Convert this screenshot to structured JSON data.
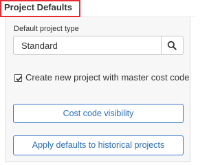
{
  "section": {
    "title": "Project Defaults"
  },
  "default_project_type": {
    "label": "Default project type",
    "value": "Standard",
    "search_icon": "search-icon"
  },
  "master_cost_code": {
    "checked": true,
    "label": "Create new project with master cost code"
  },
  "buttons": {
    "cost_code_visibility": "Cost code visibility",
    "apply_defaults": "Apply defaults to historical projects"
  },
  "colors": {
    "highlight": "#e52a32",
    "button_border": "#3a7bc8",
    "button_text": "#2a6db5"
  }
}
